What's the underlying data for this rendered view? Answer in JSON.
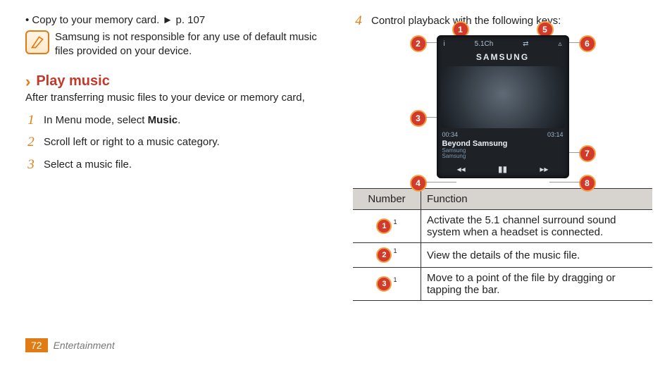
{
  "left": {
    "bullet": "Copy to your memory card. ► p. 107",
    "note": "Samsung is not responsible for any use of default music files provided on your device.",
    "heading": "Play music",
    "desc": "After transferring music files to your device or memory card,",
    "step1_pre": "In Menu mode, select ",
    "step1_bold": "Music",
    "step1_post": ".",
    "step2": "Scroll left or right to a music category.",
    "step3": "Select a music file."
  },
  "right": {
    "step4": "Control playback with the following keys:",
    "player": {
      "top_info": "i",
      "top_51": "5.1Ch",
      "top_hz": "⇄",
      "top_caret": "▵",
      "brand": "SAMSUNG",
      "time_cur": "00:34",
      "time_tot": "03:14",
      "track": "Beyond Samsung",
      "artist": "Samsung",
      "album": "Samsung",
      "prev": "◂◂",
      "play": "▮▮",
      "next": "▸▸"
    },
    "table": {
      "h1": "Number",
      "h2": "Function",
      "r1": "Activate the 5.1 channel surround sound system when a headset is connected.",
      "r2": "View the details of the music file.",
      "r3": "Move to a point of the file by dragging or tapping the bar."
    }
  },
  "footer": {
    "page": "72",
    "cat": "Entertainment"
  }
}
